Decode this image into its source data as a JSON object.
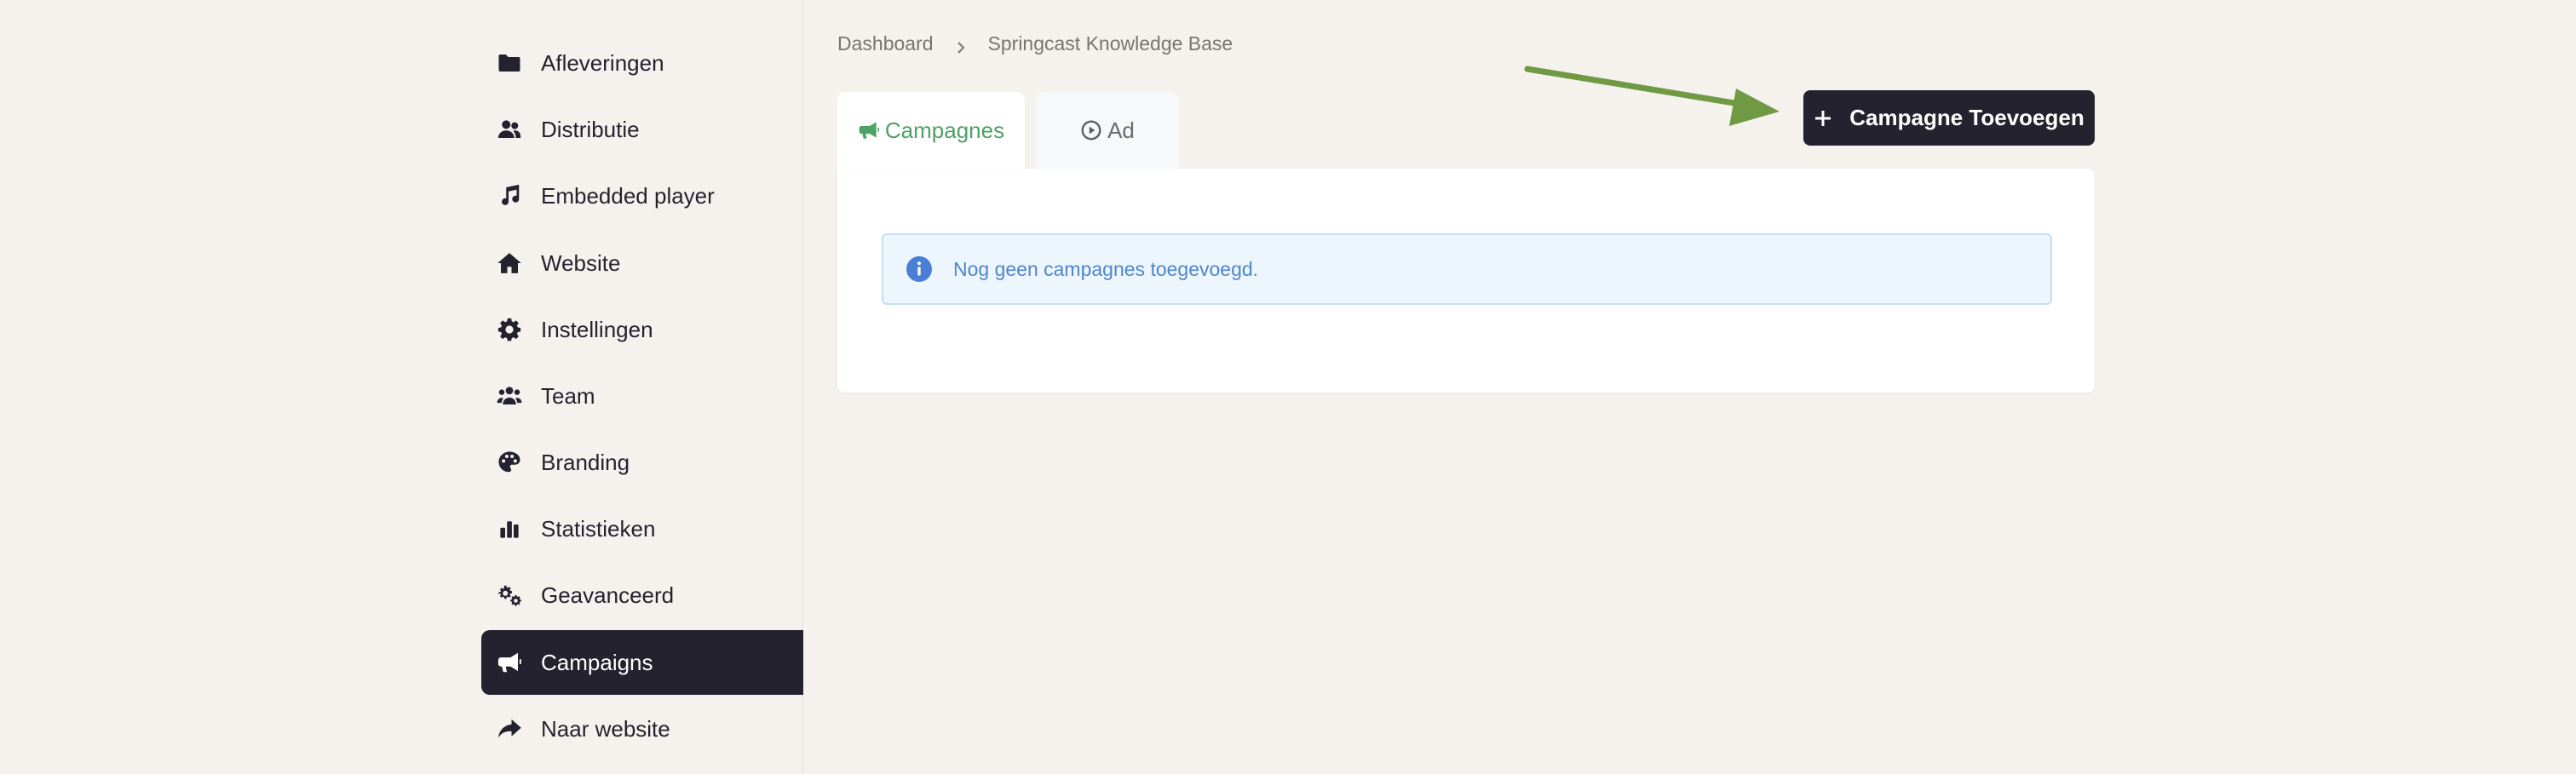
{
  "sidebar": {
    "items": [
      {
        "label": "Afleveringen",
        "icon": "folder-icon",
        "active": false
      },
      {
        "label": "Distributie",
        "icon": "users-icon",
        "active": false
      },
      {
        "label": "Embedded player",
        "icon": "music-note-icon",
        "active": false
      },
      {
        "label": "Website",
        "icon": "home-icon",
        "active": false
      },
      {
        "label": "Instellingen",
        "icon": "gear-icon",
        "active": false
      },
      {
        "label": "Team",
        "icon": "team-icon",
        "active": false
      },
      {
        "label": "Branding",
        "icon": "palette-icon",
        "active": false
      },
      {
        "label": "Statistieken",
        "icon": "bar-chart-icon",
        "active": false
      },
      {
        "label": "Geavanceerd",
        "icon": "gears-icon",
        "active": false
      },
      {
        "label": "Campaigns",
        "icon": "megaphone-icon",
        "active": true
      },
      {
        "label": "Naar website",
        "icon": "share-arrow-icon",
        "active": false
      }
    ]
  },
  "breadcrumb": {
    "items": [
      "Dashboard",
      "Springcast Knowledge Base"
    ]
  },
  "tabs": [
    {
      "label": "Campagnes",
      "icon": "megaphone-icon",
      "active": true
    },
    {
      "label": "Ad",
      "icon": "play-circle-icon",
      "active": false
    }
  ],
  "actions": {
    "add_campaign_label": "Campagne Toevoegen",
    "add_icon": "plus-icon"
  },
  "alert": {
    "icon": "info-icon",
    "message": "Nog geen campagnes toegevoegd."
  },
  "colors": {
    "dark": "#24222e",
    "accent_green": "#4da266",
    "annotation_arrow": "#6f9a43",
    "info_blue": "#4f86cc",
    "page_background": "#f5f2ee"
  }
}
